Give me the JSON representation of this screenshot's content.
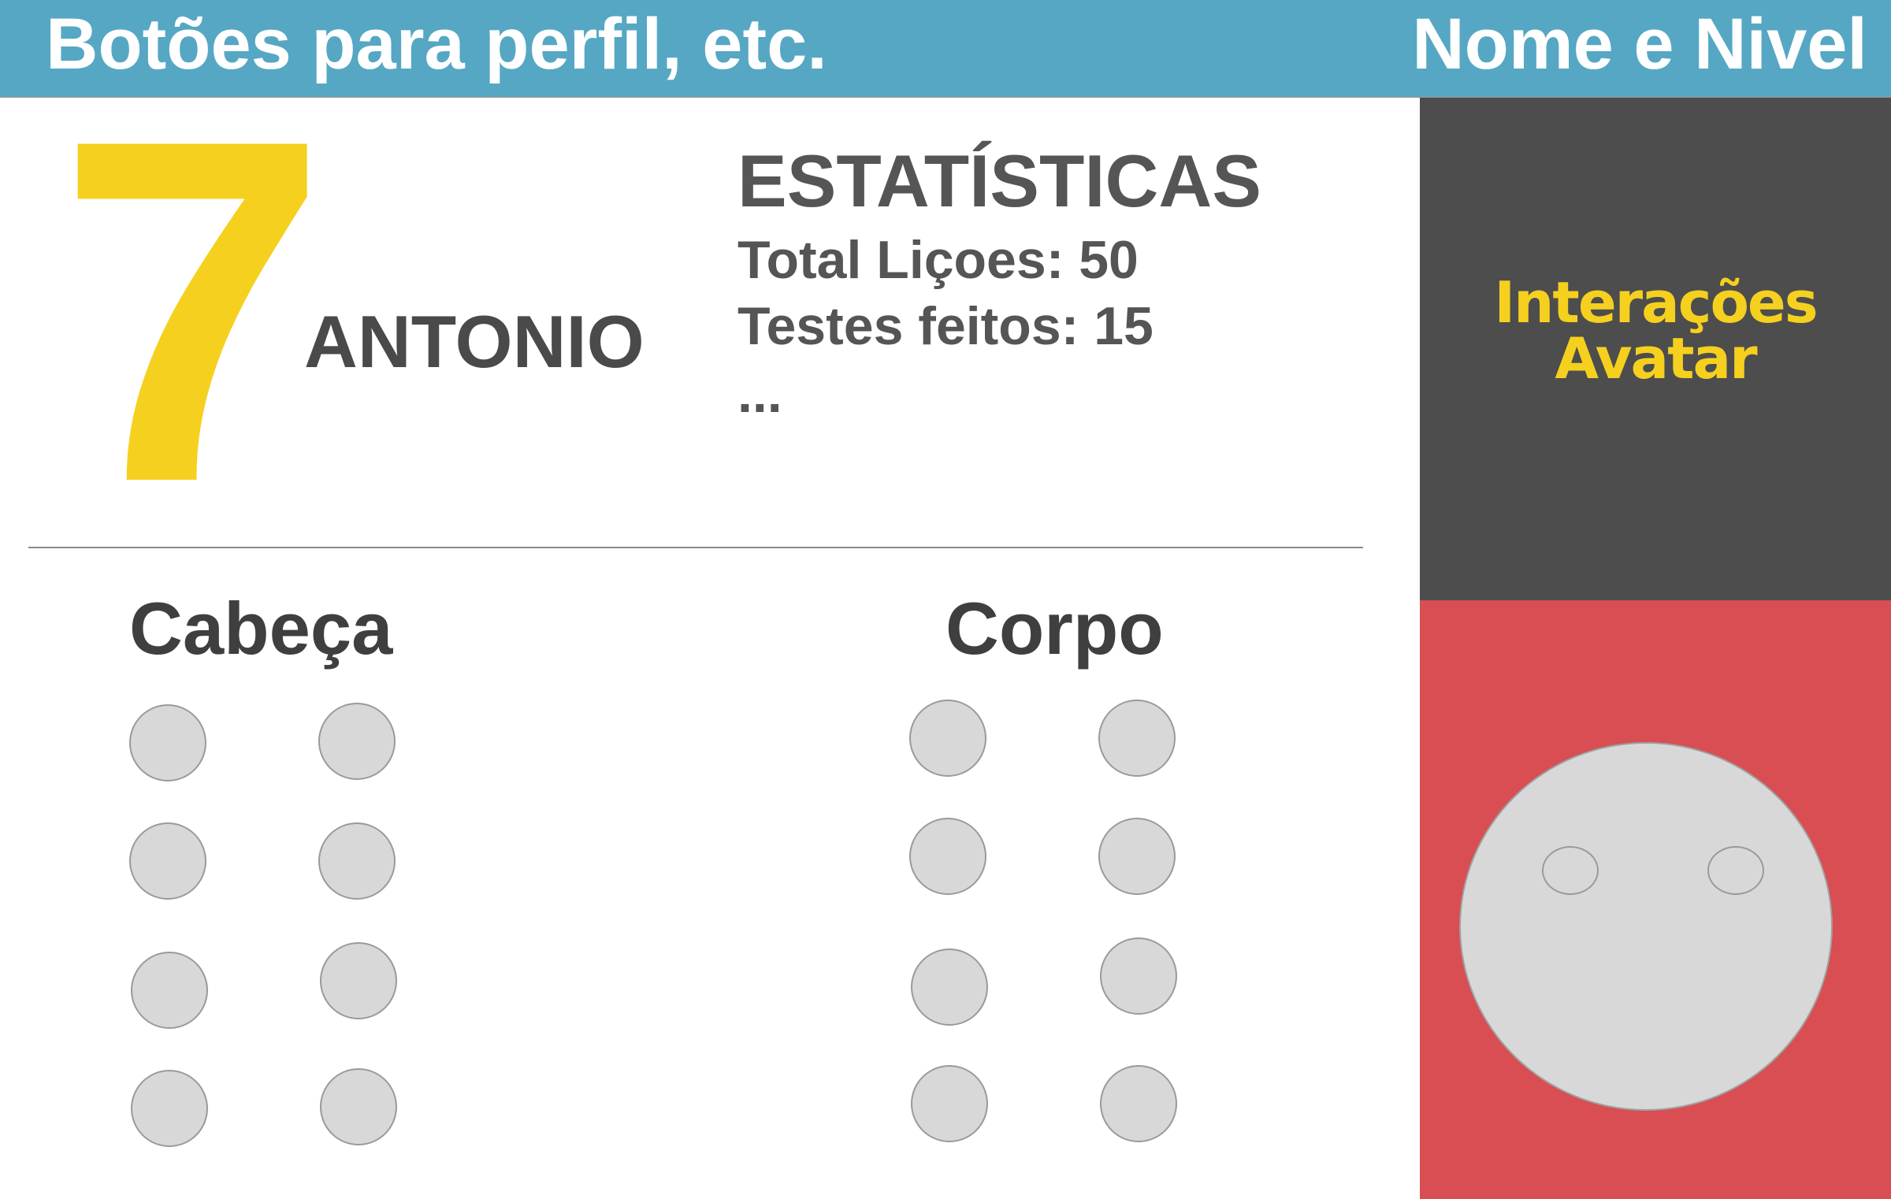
{
  "header": {
    "left_label": "Botões para perfil, etc.",
    "right_label": "Nome e Nivel",
    "background_color": "#56a7c4"
  },
  "profile": {
    "level": "7",
    "name": "ANTONIO",
    "level_color": "#f6d01e"
  },
  "stats": {
    "title": "ESTATÍSTICAS",
    "lines": [
      "Total Liçoes: 50",
      "Testes feitos: 15",
      "..."
    ]
  },
  "customization": {
    "head": {
      "title": "Cabeça",
      "option_count": 8
    },
    "body": {
      "title": "Corpo",
      "option_count": 8
    }
  },
  "avatar_panel": {
    "title_line1": "Interações",
    "title_line2": "Avatar",
    "dark_color": "#4d4d4d",
    "red_color": "#d84e52"
  }
}
